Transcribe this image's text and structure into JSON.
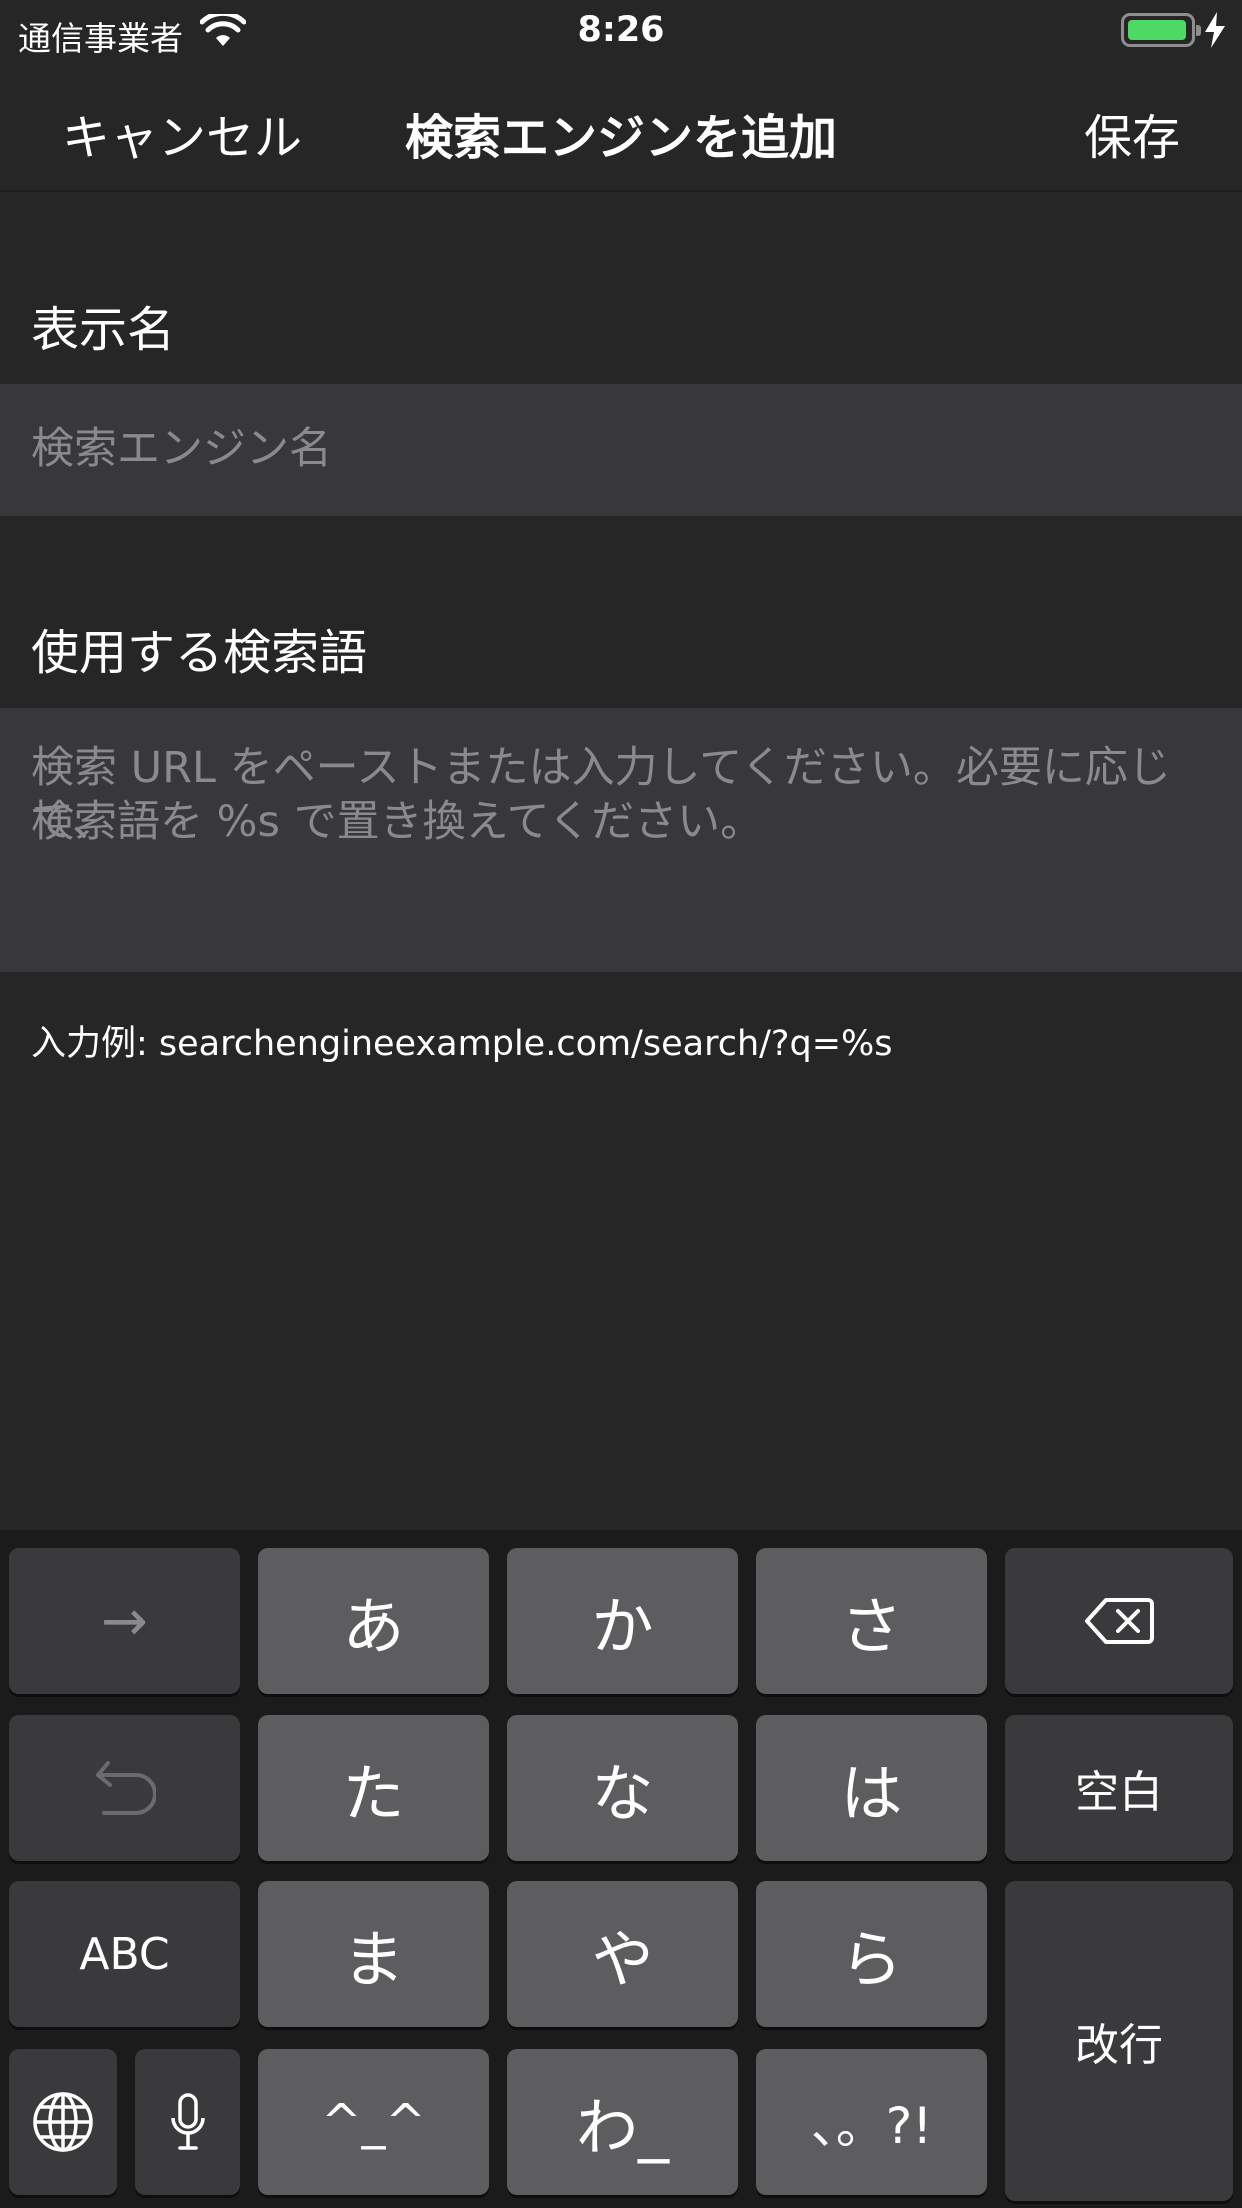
{
  "status_bar": {
    "carrier": "通信事業者",
    "time": "8:26",
    "wifi_icon": "wifi-icon",
    "battery_icon": "battery-icon",
    "charging_icon": "bolt-icon"
  },
  "nav": {
    "cancel_label": "キャンセル",
    "title": "検索エンジンを追加",
    "save_label": "保存"
  },
  "display_name": {
    "label": "表示名",
    "placeholder": "検索エンジン名"
  },
  "search_term": {
    "label": "使用する検索語",
    "placeholder_line1": "検索 URL をペーストまたは入力してください。必要に応じて、",
    "placeholder_line2": "検索語を %s で置き換えてください。"
  },
  "example": "入力例: searchengineexample.com/search/?q=%s",
  "keyboard": {
    "keys": {
      "next": "→",
      "a": "あ",
      "ka": "か",
      "sa": "さ",
      "ta": "た",
      "na": "な",
      "ha": "は",
      "space": "空白",
      "abc": "ABC",
      "ma": "ま",
      "ya": "や",
      "ra": "ら",
      "return": "改行",
      "kaomoji": "^_^",
      "wa": "わ_",
      "punct": "、。?!"
    },
    "icons": {
      "delete": "delete-icon",
      "undo": "undo-icon",
      "globe": "globe-icon",
      "mic": "microphone-icon"
    },
    "colors": {
      "main_key": "#5d5d5f",
      "function_key": "#3a3a3c",
      "background": "#1b1b1c"
    }
  }
}
